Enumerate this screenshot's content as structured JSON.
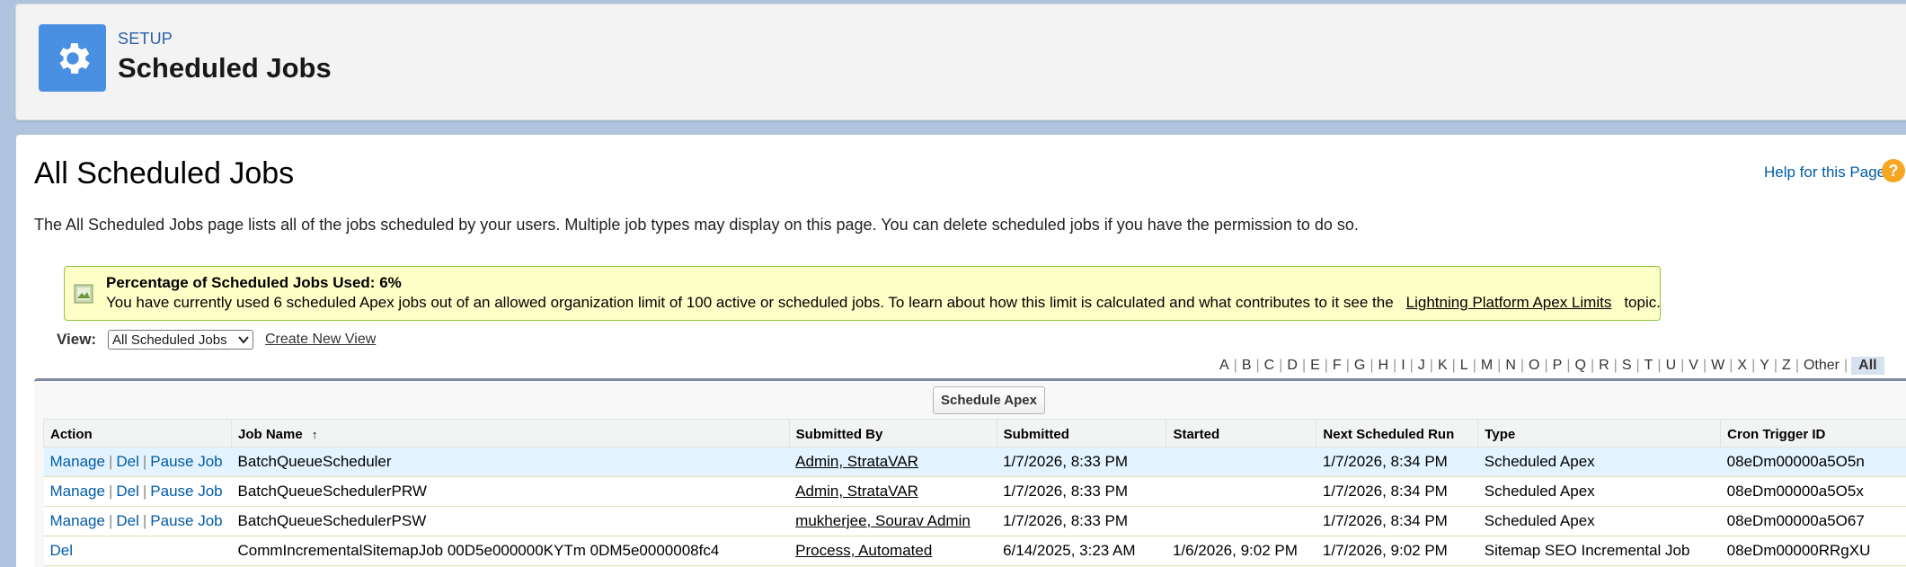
{
  "header": {
    "setup_label": "SETUP",
    "title": "Scheduled Jobs"
  },
  "page": {
    "title": "All Scheduled Jobs",
    "help_link": "Help for this Page",
    "help_icon": "?",
    "description": "The All Scheduled Jobs page lists all of the jobs scheduled by your users. Multiple job types may display on this page. You can delete scheduled jobs if you have the permission to do so."
  },
  "info": {
    "title": "Percentage of Scheduled Jobs Used: 6%",
    "text_before": "You have currently used 6 scheduled Apex jobs out of an allowed organization limit of 100 active or scheduled jobs. To learn about how this limit is calculated and what contributes to it see the",
    "link": "Lightning Platform Apex Limits",
    "text_after": "topic."
  },
  "view": {
    "label": "View:",
    "selected": "All Scheduled Jobs",
    "create_link": "Create New View"
  },
  "alphabet": [
    "A",
    "B",
    "C",
    "D",
    "E",
    "F",
    "G",
    "H",
    "I",
    "J",
    "K",
    "L",
    "M",
    "N",
    "O",
    "P",
    "Q",
    "R",
    "S",
    "T",
    "U",
    "V",
    "W",
    "X",
    "Y",
    "Z",
    "Other"
  ],
  "alphabet_all": "All",
  "toolbar": {
    "schedule_apex": "Schedule Apex"
  },
  "table": {
    "columns": [
      "Action",
      "Job Name",
      "Submitted By",
      "Submitted",
      "Started",
      "Next Scheduled Run",
      "Type",
      "Cron Trigger ID"
    ],
    "sort_indicator": "↑",
    "action_labels": {
      "manage": "Manage",
      "del": "Del",
      "pause": "Pause Job",
      "sep": "|"
    },
    "rows": [
      {
        "job_name": "BatchQueueScheduler",
        "submitted_by": "Admin, StrataVAR",
        "submitted": "1/7/2026, 8:33 PM",
        "started": "",
        "next_run": "1/7/2026, 8:34 PM",
        "type": "Scheduled Apex",
        "cron_id": "08eDm00000a5O5n"
      },
      {
        "job_name": "BatchQueueSchedulerPRW",
        "submitted_by": "Admin, StrataVAR",
        "submitted": "1/7/2026, 8:33 PM",
        "started": "",
        "next_run": "1/7/2026, 8:34 PM",
        "type": "Scheduled Apex",
        "cron_id": "08eDm00000a5O5x"
      },
      {
        "job_name": "BatchQueueSchedulerPSW",
        "submitted_by": "mukherjee, Sourav Admin",
        "submitted": "1/7/2026, 8:33 PM",
        "started": "",
        "next_run": "1/7/2026, 8:34 PM",
        "type": "Scheduled Apex",
        "cron_id": "08eDm00000a5O67"
      },
      {
        "job_name": "CommIncrementalSitemapJob 00D5e000000KYTm 0DM5e0000008fc4",
        "submitted_by": "Process, Automated",
        "submitted": "6/14/2025, 3:23 AM",
        "started": "1/6/2026, 9:02 PM",
        "next_run": "1/7/2026, 9:02 PM",
        "type": "Sitemap SEO Incremental Job",
        "cron_id": "08eDm00000RRgXU"
      }
    ]
  }
}
